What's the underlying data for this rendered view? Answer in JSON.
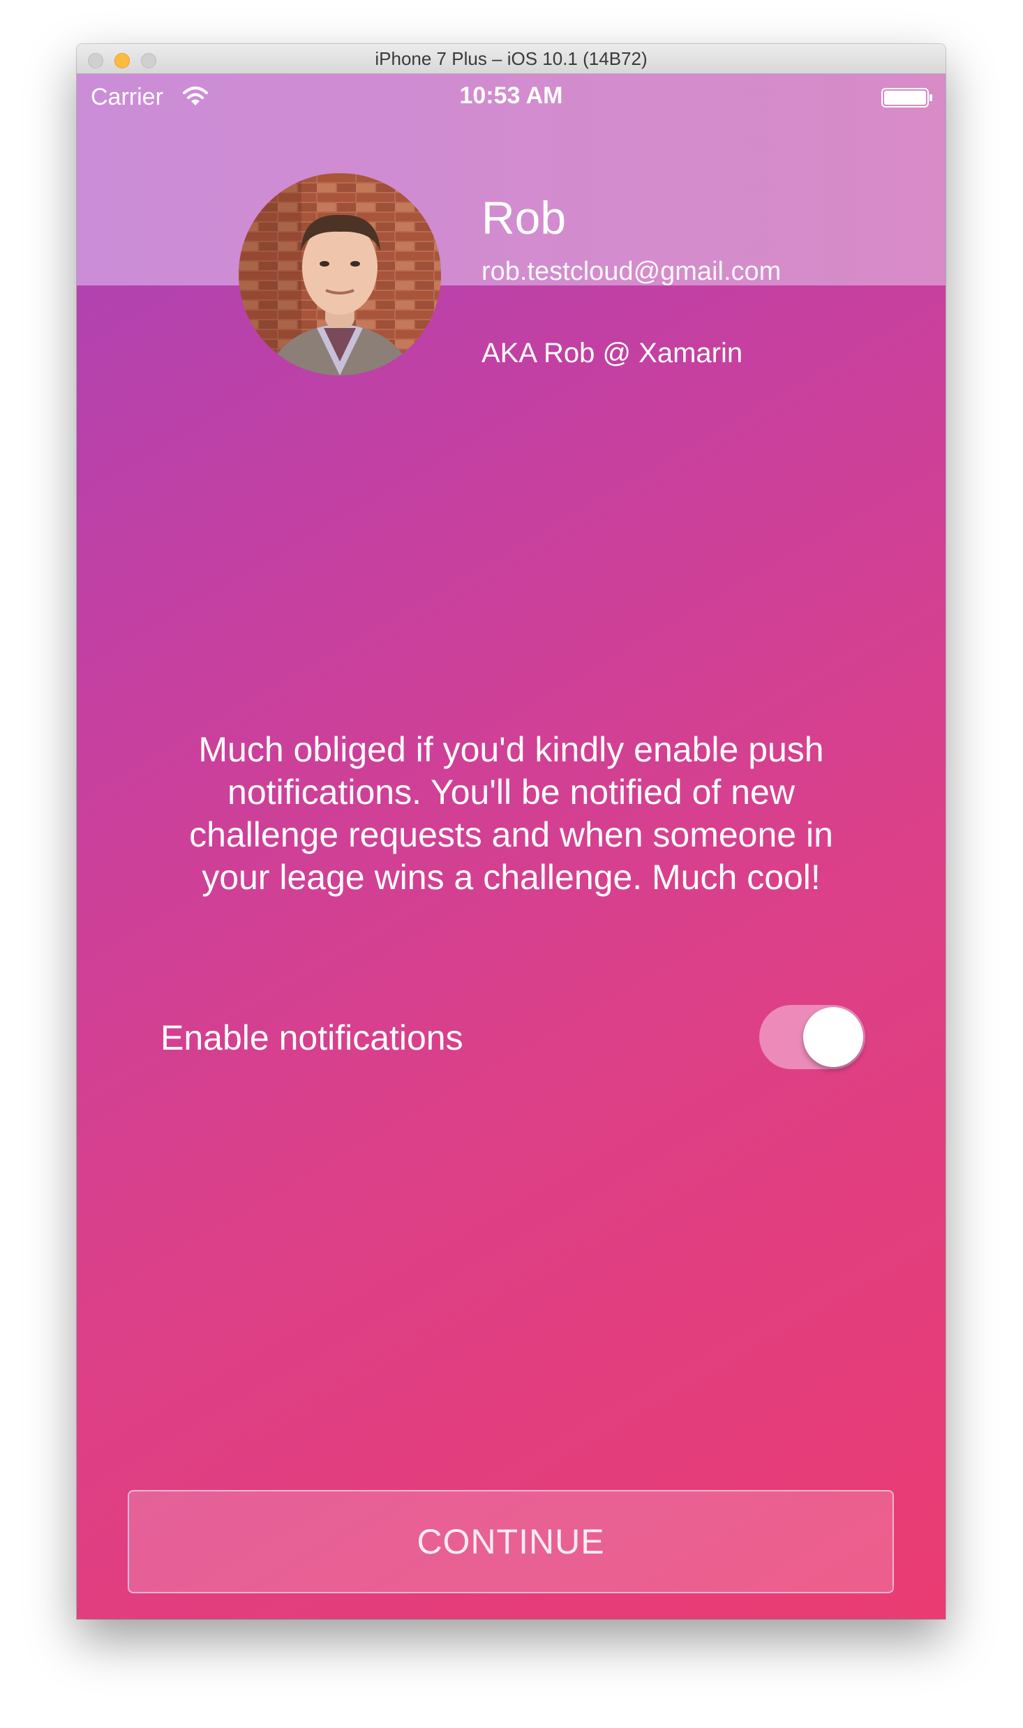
{
  "window": {
    "title": "iPhone 7 Plus – iOS 10.1 (14B72)"
  },
  "status_bar": {
    "carrier": "Carrier",
    "time": "10:53 AM",
    "icons": [
      "wifi-icon",
      "battery-icon"
    ]
  },
  "profile": {
    "name": "Rob",
    "email": "rob.testcloud@gmail.com",
    "alias": "AKA Rob @ Xamarin"
  },
  "message": "Much obliged if you'd kindly enable push notifications. You'll be notified of new challenge requests and when someone in your leage wins a challenge. Much cool!",
  "notifications": {
    "label": "Enable notifications",
    "enabled": true
  },
  "actions": {
    "continue_label": "CONTINUE"
  },
  "colors": {
    "gradient_start": "#a843b8",
    "gradient_end": "#ea3b72",
    "header_band": "#cf8dd3",
    "text": "#ffffff",
    "traffic_light_min": "#fdbc40"
  }
}
